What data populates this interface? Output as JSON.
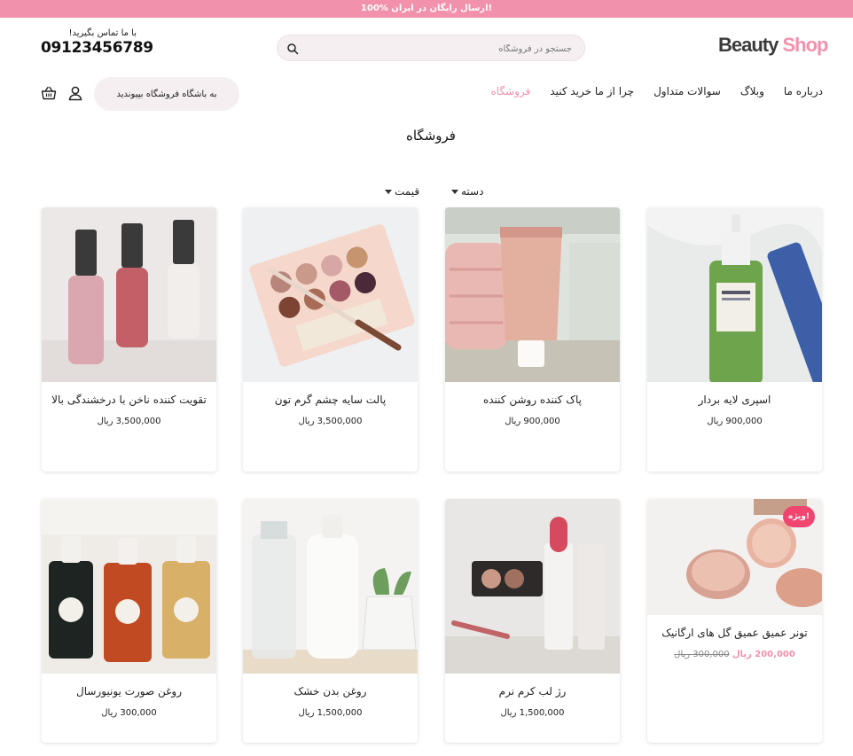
{
  "topbar": {
    "text": "100% ارسال رایگان در ایران!"
  },
  "header": {
    "logo_primary": "Beauty",
    "logo_accent": "Shop",
    "search_placeholder": "جستجو در فروشگاه",
    "search_icon": "search-icon",
    "contact_label": "با ما تماس بگیرید!",
    "contact_phone": "09123456789"
  },
  "nav": {
    "items": [
      {
        "label": "فروشگاه",
        "active": true
      },
      {
        "label": "چرا از ما خرید کنید",
        "active": false
      },
      {
        "label": "سوالات متداول",
        "active": false
      },
      {
        "label": "وبلاگ",
        "active": false
      },
      {
        "label": "درباره ما",
        "active": false
      }
    ],
    "club_button": "به باشگاه فروشگاه بپیوندید",
    "user_icon": "user-icon",
    "cart_icon": "shopping-basket-icon"
  },
  "page": {
    "title": "فروشگاه"
  },
  "filters": {
    "category": "دسته",
    "price": "قیمت"
  },
  "colors": {
    "accent": "#f291ab",
    "badge": "#f0456f",
    "pill_bg": "#f5eff1"
  },
  "products": [
    {
      "name": "اسپری لایه بردار",
      "price": "900,000 ریال"
    },
    {
      "name": "پاک کننده روشن کننده",
      "price": "900,000 ریال"
    },
    {
      "name": "پالت سایه چشم گرم تون",
      "price": "3,500,000 ریال"
    },
    {
      "name": "تقویت کننده ناخن با درخشندگی بالا",
      "price": "3,500,000 ریال"
    },
    {
      "name": "تونر عمیق عمیق گل های ارگانیک",
      "old_price": "300,000 ریال",
      "new_price": "200,000 ریال",
      "badge": "ویژه!"
    },
    {
      "name": "رژ لب کرم نرم",
      "price": "1,500,000 ریال"
    },
    {
      "name": "روغن بدن خشک",
      "price": "1,500,000 ریال"
    },
    {
      "name": "روغن صورت یونیورسال",
      "price": "300,000 ریال"
    }
  ]
}
